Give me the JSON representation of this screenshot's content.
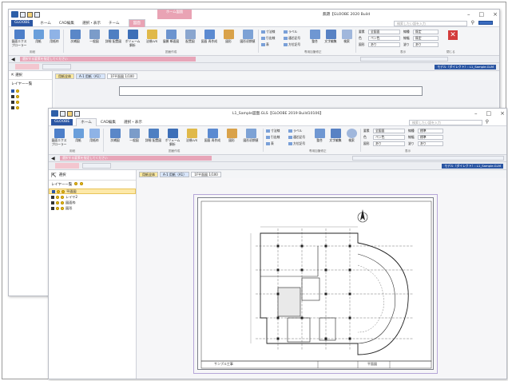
{
  "back_window": {
    "title": "無題【GLOOBE 2020 Build",
    "context_tab": "ホーム図面",
    "menu": {
      "file": "GLOOBE",
      "tabs": [
        "ホーム",
        "CAD編集",
        "選択・表示",
        "チーム",
        "図面"
      ]
    },
    "search_placeholder": "検索したい語を入力",
    "ribbon": {
      "buttons": [
        "図面エクスプローラー",
        "用紙",
        "用紙枠",
        "次補図",
        "一般図",
        "詳細\n配置図",
        "ボリューム\n解析",
        "法規LVS",
        "展開\n断面図",
        "配置図",
        "図面\n再作成",
        "図形",
        "図形初期値"
      ],
      "small": [
        "寸法線",
        "引出線",
        "表",
        "ラベル",
        "通芯記号",
        "方位記号"
      ],
      "buttons_right": [
        "整合",
        "文字編集",
        "検索"
      ],
      "group_labels": [
        "用紙",
        "図面作成",
        "専用加筆修正",
        "表示",
        "閉じる"
      ],
      "props": {
        "layer_label": "要素",
        "layer_value": "全図面",
        "color_label": "色",
        "color_value": "ペン色",
        "fill_label": "図形",
        "fill_value": "あり",
        "line_label": "線種",
        "line_value": "既定",
        "width_label": "線幅",
        "width_value": "既定",
        "fill2_label": "塗り",
        "fill2_value": "あり"
      },
      "close_label": "閉じる"
    },
    "sel_bar": "選択する要素を指定してください",
    "model_label": "モデル（ダイレクト）: L1_Sample.GLM",
    "panel": {
      "select_label": "選択",
      "layer_header": "レイヤー一覧",
      "layer_link": "レイヤー"
    },
    "doc_tabs": [
      "用紙全体",
      "A-1 用紙（A1）"
    ],
    "scale_tab": "1F平面図 1/100"
  },
  "front_window": {
    "title": "L1_Sample図面.GLS【GLOOBE 2019 Build10106】",
    "menu": {
      "file": "GLOOBE",
      "tabs": [
        "ホーム",
        "CAD編集",
        "選択・表示"
      ]
    },
    "search_placeholder": "検索したい語を入力",
    "ribbon": {
      "buttons": [
        "図面エクスプローラー",
        "用紙",
        "用紙枠",
        "次補図",
        "一般図",
        "詳細\n配置図",
        "ボリューム\n解析",
        "法規LVS",
        "図面\n再作成",
        "図形",
        "図形初期値"
      ],
      "small": [
        "寸法線",
        "引出線",
        "表",
        "ラベル",
        "通芯記号",
        "方位記号"
      ],
      "buttons_right": [
        "整合",
        "文字編集",
        "検索"
      ],
      "group_labels": [
        "用紙",
        "図面作成",
        "専用加筆修正",
        "表示"
      ],
      "props": {
        "layer_label": "要素",
        "layer_value": "全図面",
        "color_label": "色",
        "color_value": "ペン色",
        "fill_label": "図形",
        "fill_value": "あり",
        "line_label": "線種",
        "line_value": "標準",
        "width_label": "線幅",
        "width_value": "標準",
        "fill2_label": "塗り",
        "fill2_value": "あり"
      }
    },
    "sel_bar": "選択する要素を指定してください",
    "model_label": "モデル（ダイレクト）: L1_Sample.GLM",
    "panel": {
      "select_label": "選択",
      "layer_header": "レイヤー一覧",
      "layers": [
        {
          "name": "平面図",
          "selected": true
        },
        {
          "name": "レイヤ2",
          "selected": false
        },
        {
          "name": "図面枠",
          "selected": false
        },
        {
          "name": "図形",
          "selected": false
        }
      ]
    },
    "doc_tabs": [
      "用紙全体",
      "A-1 用紙（A1）"
    ],
    "scale_tab": "1F平面図 1/100",
    "title_block": {
      "project": "サンプル工事",
      "drawing": "平面図"
    }
  },
  "colors": {
    "file_blue": "#2b56a3",
    "context_pink": "#e9a3b4",
    "close_red": "#d33c3c",
    "selected_layer": "#fde9a9"
  }
}
